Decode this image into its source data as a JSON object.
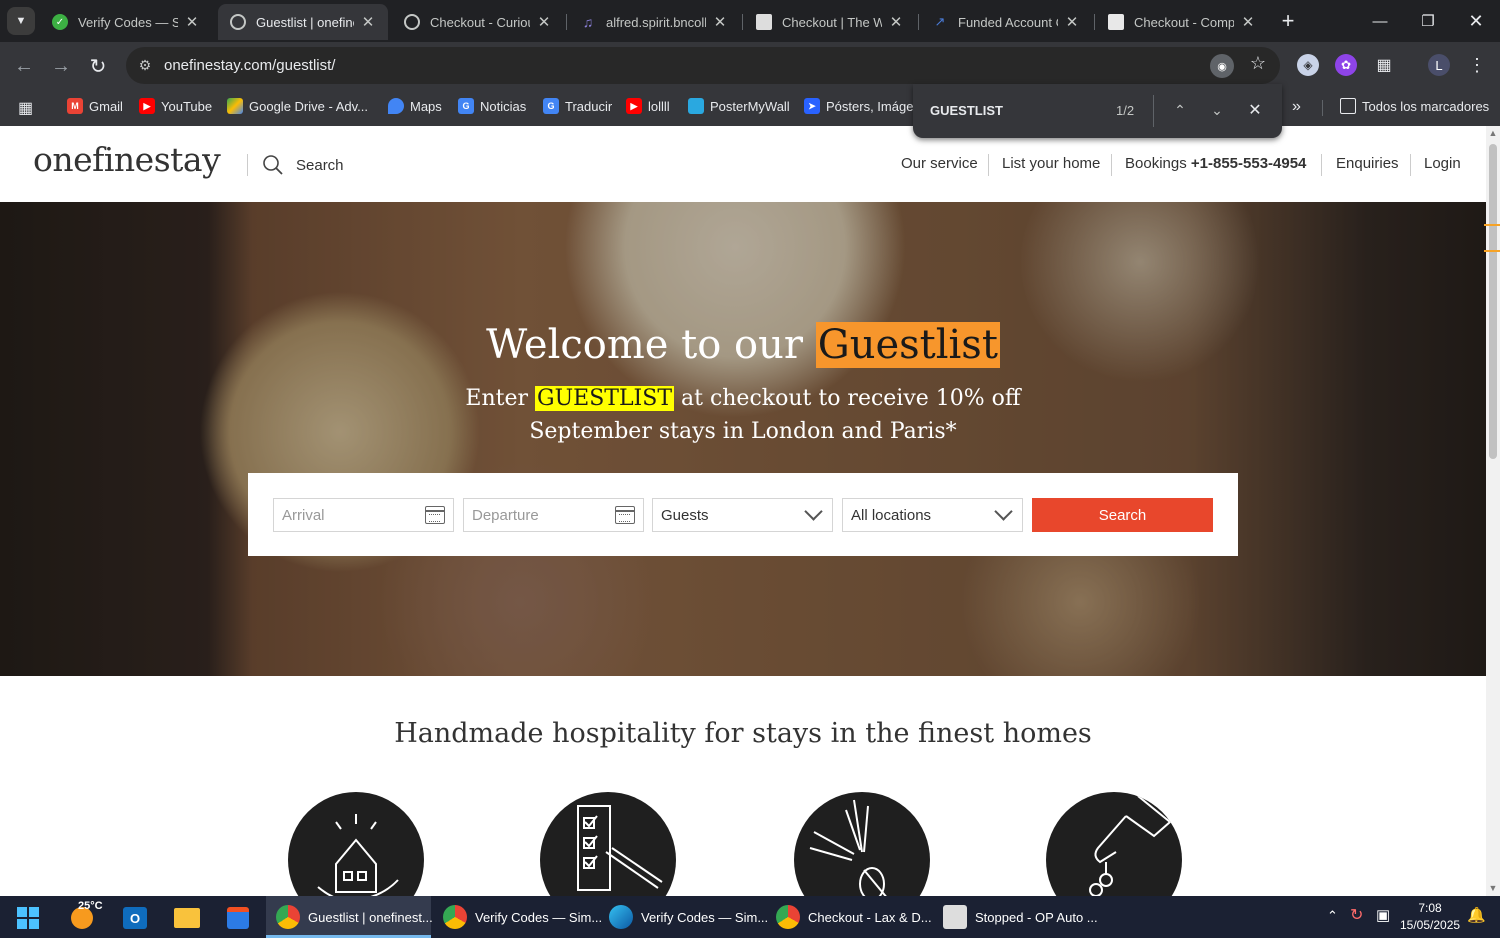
{
  "browser": {
    "tabs": [
      {
        "title": "Verify Codes — Si",
        "icon": "verify-icon",
        "color": "#3cb043"
      },
      {
        "title": "Guestlist | onefine",
        "icon": "globe-icon",
        "color": "#9aa0a6",
        "active": true
      },
      {
        "title": "Checkout - Curiou",
        "icon": "globe-icon",
        "color": "#9aa0a6"
      },
      {
        "title": "alfred.spirit.bncoll",
        "icon": "music-icon",
        "color": "#8a7fd6"
      },
      {
        "title": "Checkout | The Wi",
        "icon": "page-icon",
        "color": "#dddddd"
      },
      {
        "title": "Funded Account C",
        "icon": "chart-icon",
        "color": "#4a7bd6"
      },
      {
        "title": "Checkout - Comp",
        "icon": "page-icon",
        "color": "#e8e8e8"
      }
    ],
    "url": "onefinestay.com/guestlist/",
    "bookmarks": [
      {
        "label": "Gmail",
        "icon": "gmail-icon",
        "color": "#ea4335"
      },
      {
        "label": "YouTube",
        "icon": "youtube-icon",
        "color": "#ff0000"
      },
      {
        "label": "Google Drive - Adv...",
        "icon": "drive-icon",
        "color": "#34a853"
      },
      {
        "label": "Maps",
        "icon": "maps-icon",
        "color": "#4285f4"
      },
      {
        "label": "Noticias",
        "icon": "news-icon",
        "color": "#4285f4"
      },
      {
        "label": "Traducir",
        "icon": "translate-icon",
        "color": "#4285f4"
      },
      {
        "label": "lollll",
        "icon": "youtube-icon",
        "color": "#ff0000"
      },
      {
        "label": "PosterMyWall",
        "icon": "postermywall-icon",
        "color": "#2aa8e0"
      },
      {
        "label": "Pósters, Imágen",
        "icon": "poster-icon",
        "color": "#2962ff"
      }
    ],
    "all_bookmarks": "Todos los marcadores",
    "find": {
      "query": "GUESTLIST",
      "count": "1/2"
    },
    "profile_initial": "L"
  },
  "site": {
    "logo": "onefinestay",
    "search_label": "Search",
    "nav": {
      "our_service": "Our service",
      "list_home": "List your home",
      "bookings_label": "Bookings",
      "bookings_phone": "+1-855-553-4954",
      "enquiries": "Enquiries",
      "login": "Login"
    },
    "hero": {
      "title_pre": "Welcome to our ",
      "title_highlight": "Guestlist",
      "sub_pre": "Enter ",
      "sub_code": "GUESTLIST",
      "sub_post": " at checkout to receive 10% off September stays in London and Paris*"
    },
    "booking": {
      "arrival_placeholder": "Arrival",
      "departure_placeholder": "Departure",
      "guests": "Guests",
      "locations": "All locations",
      "search_button": "Search"
    },
    "section_title": "Handmade hospitality for stays in the finest homes"
  },
  "taskbar": {
    "weather": "25°C",
    "apps": [
      {
        "label": "Guestlist | onefinest...",
        "active": true
      },
      {
        "label": "Verify Codes — Sim..."
      },
      {
        "label": "Verify Codes — Sim..."
      },
      {
        "label": "Checkout - Lax & D..."
      },
      {
        "label": "Stopped - OP Auto ..."
      }
    ],
    "time": "7:08",
    "date": "15/05/2025"
  }
}
